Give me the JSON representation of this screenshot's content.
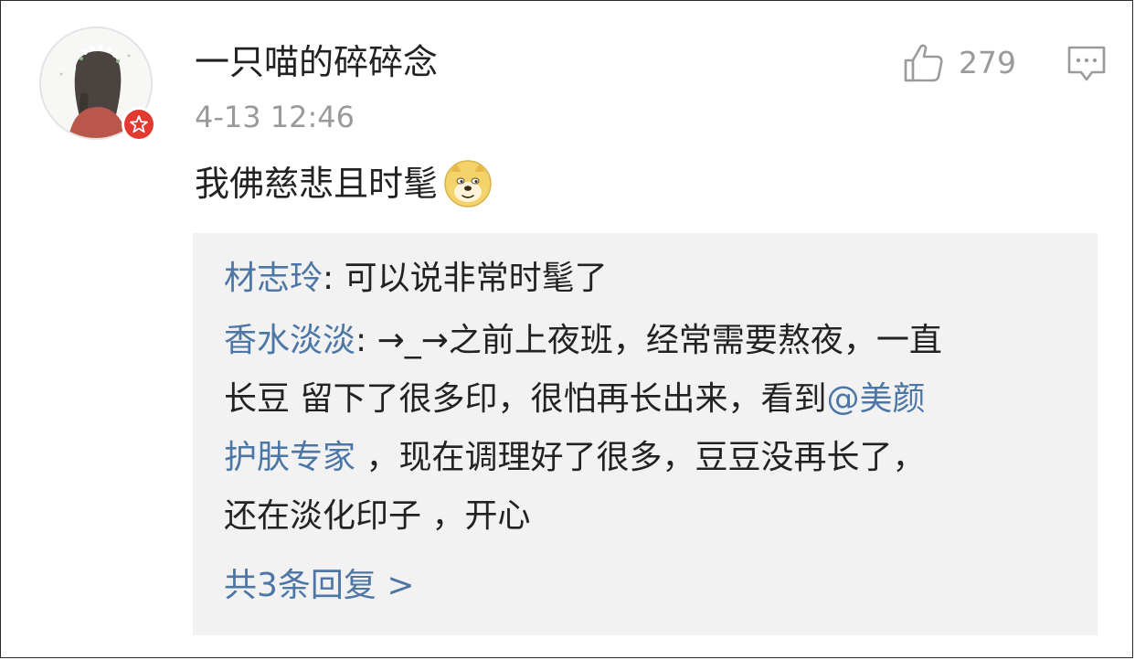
{
  "comment": {
    "username": "一只喵的碎碎念",
    "timestamp": "4-13 12:46",
    "like_count": "279",
    "text": "我佛慈悲且时髦",
    "emoji": "doge-emoji"
  },
  "icons": {
    "like": "thumbs-up-icon",
    "reply": "comment-bubble-icon",
    "verified": "verified-badge-icon"
  },
  "colors": {
    "link": "#4b76a6",
    "meta": "#9a9a9a",
    "reply_bg": "#f2f2f2",
    "badge": "#e5392f"
  },
  "replies": [
    {
      "user": "材志玲",
      "sep": ": ",
      "text": "可以说非常时髦了"
    },
    {
      "user": "香水淡淡",
      "sep": ": ",
      "line1": "→_→之前上夜班，经常需要熬夜，一直",
      "line2": "长豆  留下了很多印，很怕再长出来，看到",
      "mention_part1": "@美颜",
      "mention_part2": "护肤专家",
      "line3_rest": "  ，现在调理好了很多，豆豆没再长了，",
      "line4": "还在淡化印子   ，开心"
    }
  ],
  "more_replies": "共3条回复 >"
}
